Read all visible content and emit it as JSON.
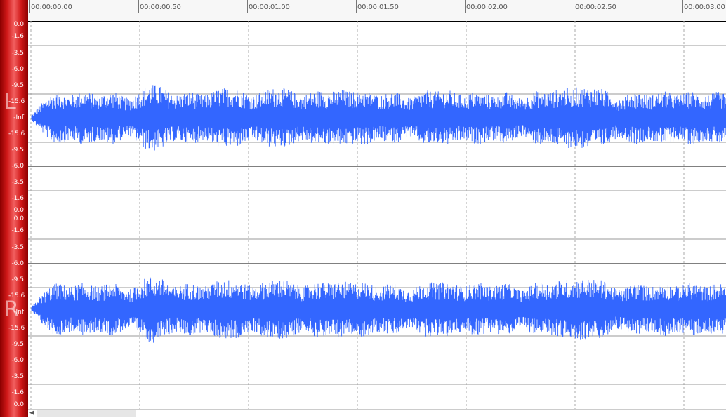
{
  "app": {
    "name": "Audio waveform editor",
    "accent_color": "#3366ff",
    "meter_color": "#d01818"
  },
  "ruler": {
    "ticks": [
      {
        "label": "00:00:00.00"
      },
      {
        "label": "00:00:00.50"
      },
      {
        "label": "00:00:01.00"
      },
      {
        "label": "00:00:01.50"
      },
      {
        "label": "00:00:02.00"
      },
      {
        "label": "00:00:02.50"
      },
      {
        "label": "00:00:03.00"
      }
    ]
  },
  "channels": {
    "left": {
      "letter": "L",
      "scale_labels": [
        "0.0",
        "-1.6",
        "-3.5",
        "-6.0",
        "-9.5",
        "-15.6",
        "-Inf",
        "-15.6",
        "-9.5",
        "-6.0",
        "-3.5",
        "-1.6",
        "0.0"
      ]
    },
    "right": {
      "letter": "R",
      "scale_labels": [
        "0.0",
        "-1.6",
        "-3.5",
        "-6.0",
        "-9.5",
        "-15.6",
        "-Inf",
        "-15.6",
        "-9.5",
        "-6.0",
        "-3.5",
        "-1.6",
        "0.0"
      ]
    }
  },
  "scrollbar": {
    "left_arrow_icon": "arrow-left-icon"
  }
}
